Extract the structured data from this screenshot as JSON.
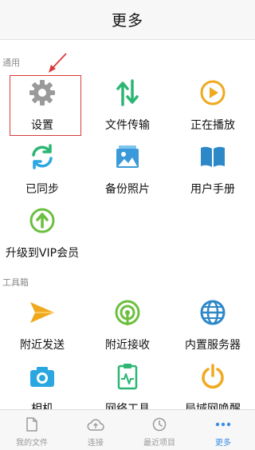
{
  "header": {
    "title": "更多"
  },
  "sections": {
    "general": "通用",
    "tools": "工具箱"
  },
  "general_items": [
    {
      "label": "设置",
      "icon": "gear-icon",
      "color": "#9a9a9a"
    },
    {
      "label": "文件传输",
      "icon": "transfer-arrows-icon",
      "color": "#2bb673"
    },
    {
      "label": "正在播放",
      "icon": "play-icon",
      "color": "#f0a91e"
    },
    {
      "label": "已同步",
      "icon": "sync-icon",
      "color": "#2bb673"
    },
    {
      "label": "备份照片",
      "icon": "photos-icon",
      "color": "#3a9ad9"
    },
    {
      "label": "用户手册",
      "icon": "book-icon",
      "color": "#2d88c8"
    },
    {
      "label": "升级到VIP会员",
      "icon": "upgrade-icon",
      "color": "#6cbf3e"
    }
  ],
  "tool_items": [
    {
      "label": "附近发送",
      "icon": "send-icon",
      "color": "#f0a91e"
    },
    {
      "label": "附近接收",
      "icon": "receive-signal-icon",
      "color": "#6cbf3e"
    },
    {
      "label": "内置服务器",
      "icon": "globe-icon",
      "color": "#2d88c8"
    },
    {
      "label": "相机",
      "icon": "camera-icon",
      "color": "#2aa7e0"
    },
    {
      "label": "网络工具",
      "icon": "network-tool-icon",
      "color": "#2bb673"
    },
    {
      "label": "局域网唤醒",
      "icon": "power-icon",
      "color": "#f0a91e"
    }
  ],
  "tabs": [
    {
      "label": "我的文件",
      "icon": "document-icon",
      "active": false
    },
    {
      "label": "连接",
      "icon": "cloud-upload-icon",
      "active": false
    },
    {
      "label": "最近项目",
      "icon": "clock-icon",
      "active": false
    },
    {
      "label": "更多",
      "icon": "more-dots-icon",
      "active": true
    }
  ],
  "colors": {
    "accent": "#3a8ee6",
    "highlight": "#d93a3a",
    "muted": "#9a9a9a"
  }
}
